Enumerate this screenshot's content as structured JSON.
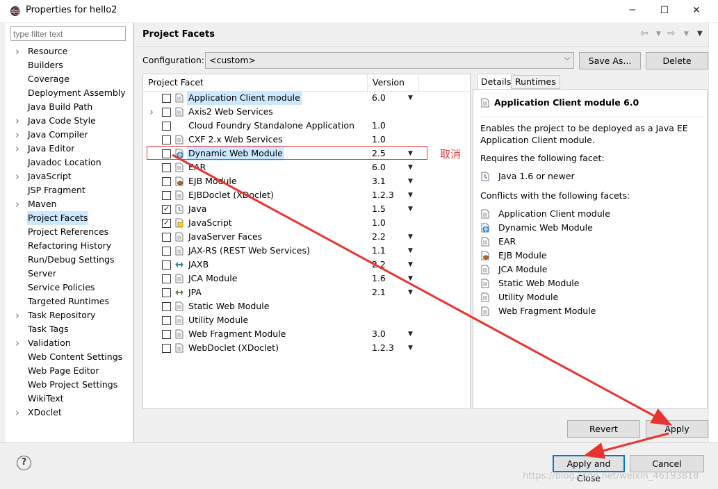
{
  "window": {
    "title": "Properties for hello2",
    "minimize": "─",
    "maximize": "☐",
    "close": "✕"
  },
  "filter": {
    "placeholder": "type filter text"
  },
  "nav": [
    {
      "label": "Resource",
      "expandable": true
    },
    {
      "label": "Builders",
      "expandable": false
    },
    {
      "label": "Coverage",
      "expandable": false
    },
    {
      "label": "Deployment Assembly",
      "expandable": false
    },
    {
      "label": "Java Build Path",
      "expandable": false
    },
    {
      "label": "Java Code Style",
      "expandable": true
    },
    {
      "label": "Java Compiler",
      "expandable": true
    },
    {
      "label": "Java Editor",
      "expandable": true
    },
    {
      "label": "Javadoc Location",
      "expandable": false
    },
    {
      "label": "JavaScript",
      "expandable": true
    },
    {
      "label": "JSP Fragment",
      "expandable": false
    },
    {
      "label": "Maven",
      "expandable": true
    },
    {
      "label": "Project Facets",
      "expandable": false,
      "selected": true
    },
    {
      "label": "Project References",
      "expandable": false
    },
    {
      "label": "Refactoring History",
      "expandable": false
    },
    {
      "label": "Run/Debug Settings",
      "expandable": false
    },
    {
      "label": "Server",
      "expandable": false
    },
    {
      "label": "Service Policies",
      "expandable": false
    },
    {
      "label": "Targeted Runtimes",
      "expandable": false
    },
    {
      "label": "Task Repository",
      "expandable": true
    },
    {
      "label": "Task Tags",
      "expandable": false
    },
    {
      "label": "Validation",
      "expandable": true
    },
    {
      "label": "Web Content Settings",
      "expandable": false
    },
    {
      "label": "Web Page Editor",
      "expandable": false
    },
    {
      "label": "Web Project Settings",
      "expandable": false
    },
    {
      "label": "WikiText",
      "expandable": false
    },
    {
      "label": "XDoclet",
      "expandable": true
    }
  ],
  "header": {
    "title": "Project Facets"
  },
  "configuration": {
    "label": "Configuration:",
    "value": "<custom>",
    "save_as": "Save As...",
    "delete": "Delete"
  },
  "table": {
    "col_facet": "Project Facet",
    "col_version": "Version",
    "rows": [
      {
        "name": "Application Client module",
        "version": "6.0",
        "checked": false,
        "dropdown": true,
        "icon": "doc-icon",
        "selected": true
      },
      {
        "name": "Axis2 Web Services",
        "version": "",
        "checked": false,
        "dropdown": false,
        "expandable": true,
        "icon": "doc-icon"
      },
      {
        "name": "Cloud Foundry Standalone Application",
        "version": "1.0",
        "checked": false,
        "dropdown": false,
        "icon": "none"
      },
      {
        "name": "CXF 2.x Web Services",
        "version": "1.0",
        "checked": false,
        "dropdown": false,
        "icon": "doc-icon"
      },
      {
        "name": "Dynamic Web Module",
        "version": "2.5",
        "checked": false,
        "dropdown": true,
        "icon": "globe-icon",
        "selected": true
      },
      {
        "name": "EAR",
        "version": "6.0",
        "checked": false,
        "dropdown": true,
        "icon": "doc-icon"
      },
      {
        "name": "EJB Module",
        "version": "3.1",
        "checked": false,
        "dropdown": true,
        "icon": "bean-icon"
      },
      {
        "name": "EJBDoclet (XDoclet)",
        "version": "1.2.3",
        "checked": false,
        "dropdown": true,
        "icon": "doc-icon"
      },
      {
        "name": "Java",
        "version": "1.5",
        "checked": true,
        "dropdown": true,
        "icon": "java-icon"
      },
      {
        "name": "JavaScript",
        "version": "1.0",
        "checked": true,
        "dropdown": false,
        "icon": "js-icon"
      },
      {
        "name": "JavaServer Faces",
        "version": "2.2",
        "checked": false,
        "dropdown": true,
        "icon": "doc-icon"
      },
      {
        "name": "JAX-RS (REST Web Services)",
        "version": "1.1",
        "checked": false,
        "dropdown": true,
        "icon": "doc-icon"
      },
      {
        "name": "JAXB",
        "version": "2.2",
        "checked": false,
        "dropdown": true,
        "icon": "jaxb-icon"
      },
      {
        "name": "JCA Module",
        "version": "1.6",
        "checked": false,
        "dropdown": true,
        "icon": "doc-icon"
      },
      {
        "name": "JPA",
        "version": "2.1",
        "checked": false,
        "dropdown": true,
        "icon": "jpa-icon"
      },
      {
        "name": "Static Web Module",
        "version": "",
        "checked": false,
        "dropdown": false,
        "icon": "doc-icon"
      },
      {
        "name": "Utility Module",
        "version": "",
        "checked": false,
        "dropdown": false,
        "icon": "doc-icon"
      },
      {
        "name": "Web Fragment Module",
        "version": "3.0",
        "checked": false,
        "dropdown": true,
        "icon": "doc-icon"
      },
      {
        "name": "WebDoclet (XDoclet)",
        "version": "1.2.3",
        "checked": false,
        "dropdown": true,
        "icon": "doc-icon"
      }
    ]
  },
  "annotation": {
    "cancel_note": "取消"
  },
  "tabs": {
    "details": "Details",
    "runtimes": "Runtimes"
  },
  "details": {
    "title": "Application Client module 6.0",
    "description": "Enables the project to be deployed as a Java EE Application Client module.",
    "requires_label": "Requires the following facet:",
    "requires": [
      {
        "name": "Java 1.6 or newer",
        "icon": "java-icon"
      }
    ],
    "conflicts_label": "Conflicts with the following facets:",
    "conflicts": [
      {
        "name": "Application Client module",
        "icon": "doc-icon"
      },
      {
        "name": "Dynamic Web Module",
        "icon": "globe-icon"
      },
      {
        "name": "EAR",
        "icon": "doc-icon"
      },
      {
        "name": "EJB Module",
        "icon": "bean-icon"
      },
      {
        "name": "JCA Module",
        "icon": "doc-icon"
      },
      {
        "name": "Static Web Module",
        "icon": "doc-icon"
      },
      {
        "name": "Utility Module",
        "icon": "doc-icon"
      },
      {
        "name": "Web Fragment Module",
        "icon": "doc-icon"
      }
    ]
  },
  "buttons": {
    "revert": "Revert",
    "apply": "Apply",
    "apply_close": "Apply and Close",
    "cancel": "Cancel",
    "help": "?"
  },
  "watermark": "https://blog.csdn.net/weixin_46193818",
  "colors": {
    "accent": "#0078d7",
    "selection": "#cce8ff",
    "annotation": "#e23b3b"
  }
}
